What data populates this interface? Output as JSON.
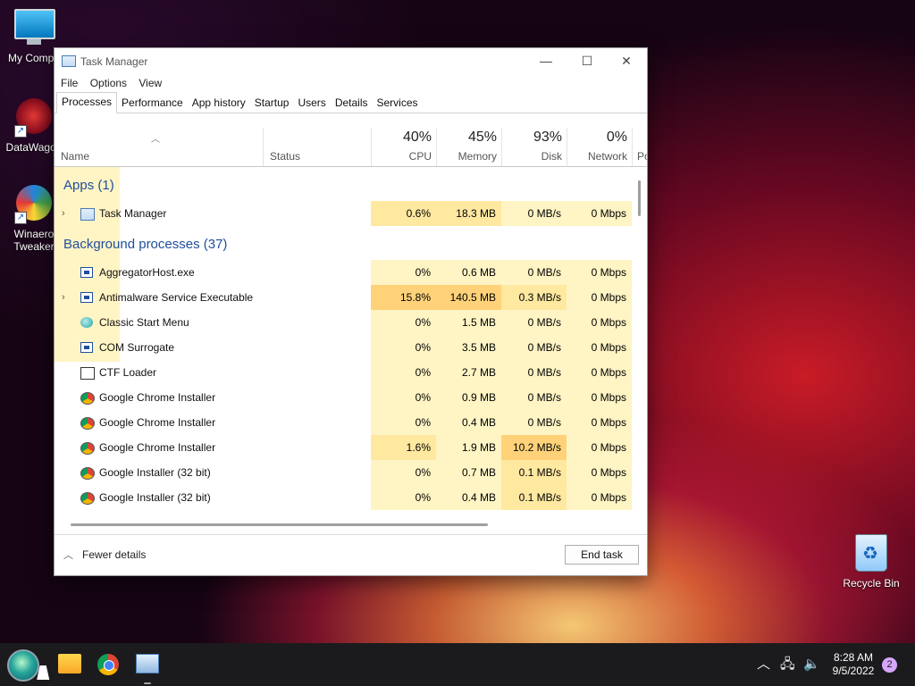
{
  "desktop": {
    "icons": [
      {
        "label": "My Compu"
      },
      {
        "label": "DataWagon"
      },
      {
        "label": "Winaero Tweaker"
      },
      {
        "label": "Recycle Bin"
      }
    ]
  },
  "window": {
    "title": "Task Manager",
    "menu": [
      "File",
      "Options",
      "View"
    ],
    "tabs": [
      "Processes",
      "Performance",
      "App history",
      "Startup",
      "Users",
      "Details",
      "Services"
    ],
    "active_tab": "Processes",
    "columns": {
      "name": "Name",
      "status": "Status",
      "cpu": {
        "pct": "40%",
        "label": "CPU"
      },
      "memory": {
        "pct": "45%",
        "label": "Memory"
      },
      "disk": {
        "pct": "93%",
        "label": "Disk"
      },
      "network": {
        "pct": "0%",
        "label": "Network"
      },
      "power": "Po"
    },
    "groups": {
      "apps": "Apps (1)",
      "background": "Background processes (37)"
    },
    "apps": [
      {
        "name": "Task Manager",
        "cpu": "0.6%",
        "mem": "18.3 MB",
        "disk": "0 MB/s",
        "net": "0 Mbps",
        "expandable": true,
        "icon": "task-manager-icon"
      }
    ],
    "background": [
      {
        "name": "AggregatorHost.exe",
        "cpu": "0%",
        "mem": "0.6 MB",
        "disk": "0 MB/s",
        "net": "0 Mbps",
        "icon": "exe-icon"
      },
      {
        "name": "Antimalware Service Executable",
        "cpu": "15.8%",
        "mem": "140.5 MB",
        "disk": "0.3 MB/s",
        "net": "0 Mbps",
        "expandable": true,
        "icon": "exe-icon"
      },
      {
        "name": "Classic Start Menu",
        "cpu": "0%",
        "mem": "1.5 MB",
        "disk": "0 MB/s",
        "net": "0 Mbps",
        "icon": "classic-shell-icon"
      },
      {
        "name": "COM Surrogate",
        "cpu": "0%",
        "mem": "3.5 MB",
        "disk": "0 MB/s",
        "net": "0 Mbps",
        "icon": "exe-icon"
      },
      {
        "name": "CTF Loader",
        "cpu": "0%",
        "mem": "2.7 MB",
        "disk": "0 MB/s",
        "net": "0 Mbps",
        "icon": "ctf-icon"
      },
      {
        "name": "Google Chrome Installer",
        "cpu": "0%",
        "mem": "0.9 MB",
        "disk": "0 MB/s",
        "net": "0 Mbps",
        "icon": "installer-icon"
      },
      {
        "name": "Google Chrome Installer",
        "cpu": "0%",
        "mem": "0.4 MB",
        "disk": "0 MB/s",
        "net": "0 Mbps",
        "icon": "installer-icon"
      },
      {
        "name": "Google Chrome Installer",
        "cpu": "1.6%",
        "mem": "1.9 MB",
        "disk": "10.2 MB/s",
        "net": "0 Mbps",
        "icon": "installer-icon"
      },
      {
        "name": "Google Installer (32 bit)",
        "cpu": "0%",
        "mem": "0.7 MB",
        "disk": "0.1 MB/s",
        "net": "0 Mbps",
        "icon": "installer-icon"
      },
      {
        "name": "Google Installer (32 bit)",
        "cpu": "0%",
        "mem": "0.4 MB",
        "disk": "0.1 MB/s",
        "net": "0 Mbps",
        "icon": "installer-icon"
      }
    ],
    "footer": {
      "fewer_details": "Fewer details",
      "end_task": "End task"
    }
  },
  "taskbar": {
    "time": "8:28 AM",
    "date": "9/5/2022",
    "notification_count": "2"
  },
  "colors": {
    "group_label": "#1f4e9c",
    "heat_low": "#fff4c4",
    "heat_mid": "#ffe8a0",
    "heat_high": "#ffd27a"
  }
}
